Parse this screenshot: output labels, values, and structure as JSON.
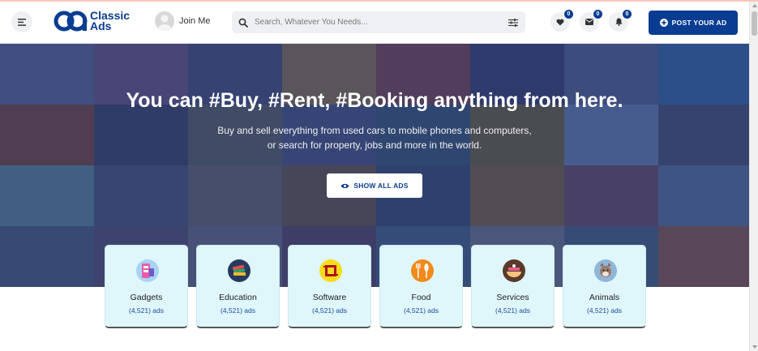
{
  "header": {
    "logo_text_line1": "Classic",
    "logo_text_line2": "Ads",
    "join_label": "Join Me",
    "search_placeholder": "Search, Whatever You Needs...",
    "wishlist_count": "0",
    "messages_count": "0",
    "notifications_count": "0",
    "post_button_label": "POST YOUR AD"
  },
  "hero": {
    "headline": "You can #Buy, #Rent, #Booking anything from here.",
    "subtext_line1": "Buy and sell everything from used cars to mobile phones and computers,",
    "subtext_line2": "or search for property, jobs and more in the world.",
    "show_button_label": "SHOW ALL ADS"
  },
  "categories": [
    {
      "name": "Gadgets",
      "count": "(4,521) ads",
      "icon": "gadgets-icon"
    },
    {
      "name": "Education",
      "count": "(4,521) ads",
      "icon": "education-icon"
    },
    {
      "name": "Software",
      "count": "(4,521) ads",
      "icon": "software-icon"
    },
    {
      "name": "Food",
      "count": "(4,521) ads",
      "icon": "food-icon"
    },
    {
      "name": "Services",
      "count": "(4,521) ads",
      "icon": "services-icon"
    },
    {
      "name": "Animals",
      "count": "(4,521) ads",
      "icon": "animals-icon"
    }
  ],
  "colors": {
    "brand": "#0a3d91",
    "card_bg": "#dff6fb",
    "hero_overlay": "#1c285c"
  }
}
